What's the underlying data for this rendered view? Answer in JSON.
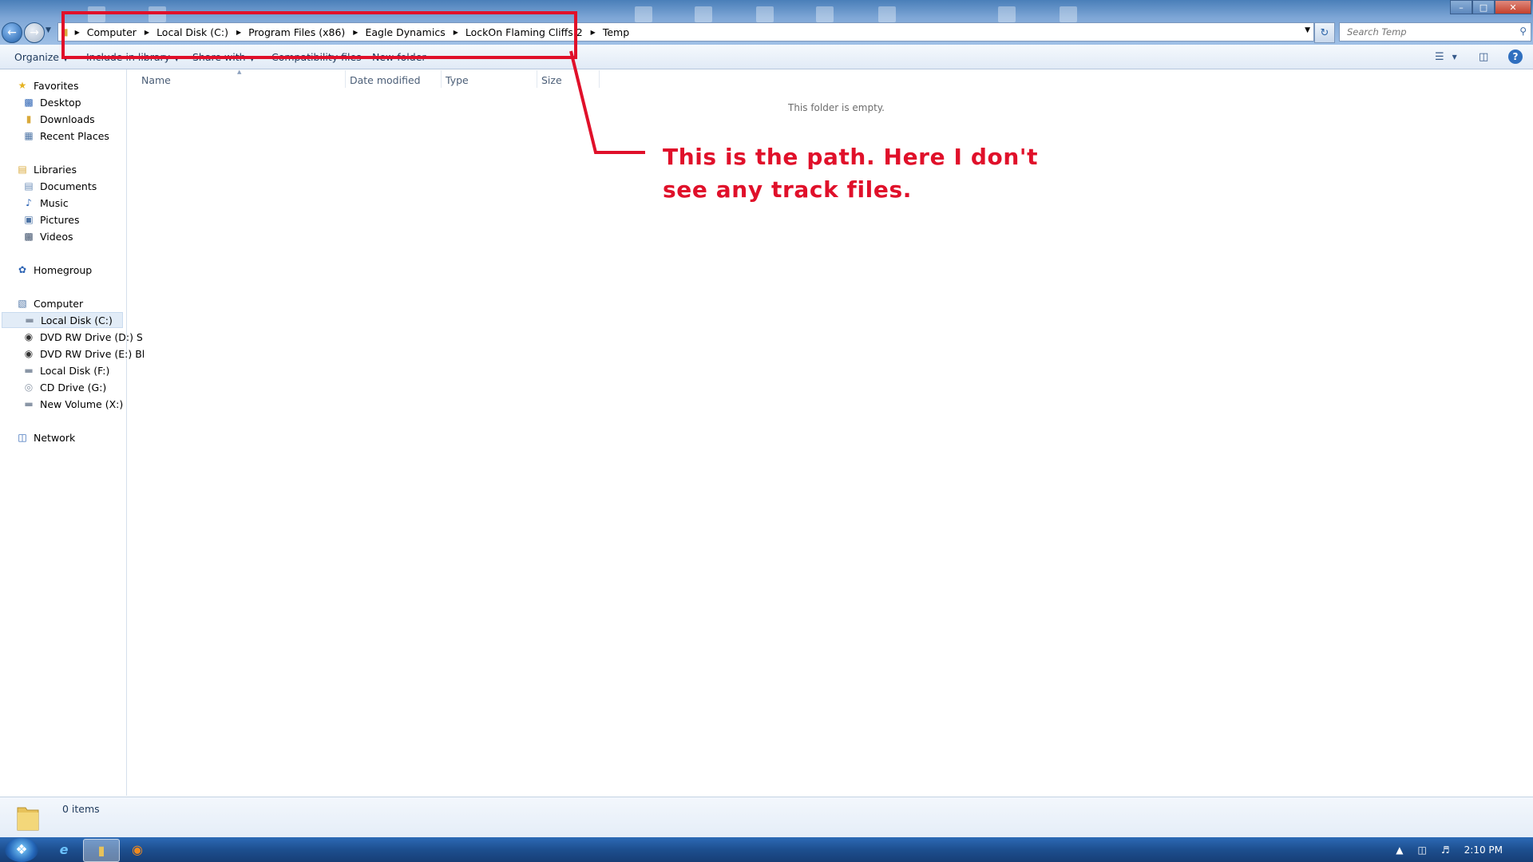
{
  "window": {
    "address_crumbs": [
      "Computer",
      "Local Disk (C:)",
      "Program Files (x86)",
      "Eagle Dynamics",
      "LockOn Flaming Cliffs 2",
      "Temp"
    ],
    "search_placeholder": "Search Temp",
    "controls": {
      "minimize": "–",
      "maximize": "□",
      "close": "✕"
    }
  },
  "commands": {
    "organize": "Organize",
    "include_in_library": "Include in library",
    "share_with": "Share with",
    "compatibility_files": "Compatibility files",
    "new_folder": "New folder"
  },
  "nav": {
    "favorites_header": "Favorites",
    "favorites": [
      "Desktop",
      "Downloads",
      "Recent Places"
    ],
    "libraries_header": "Libraries",
    "libraries": [
      "Documents",
      "Music",
      "Pictures",
      "Videos"
    ],
    "homegroup": "Homegroup",
    "computer_header": "Computer",
    "drives": [
      "Local Disk (C:)",
      "DVD RW Drive (D:) S",
      "DVD RW Drive (E:) Bl",
      "Local Disk (F:)",
      "CD Drive (G:)",
      "New Volume (X:)"
    ],
    "network": "Network",
    "selected": "Local Disk (C:)"
  },
  "columns": [
    "Name",
    "Date modified",
    "Type",
    "Size"
  ],
  "content": {
    "empty_message": "This folder is empty."
  },
  "details": {
    "items_count": "0 items"
  },
  "annotation": {
    "line1": "This is the path. Here I don't",
    "line2": "see any track files.",
    "color": "#e0102a"
  },
  "taskbar": {
    "clock": "2:10 PM",
    "apps": [
      "internet-explorer-icon",
      "windows-explorer-icon",
      "firefox-icon"
    ]
  }
}
